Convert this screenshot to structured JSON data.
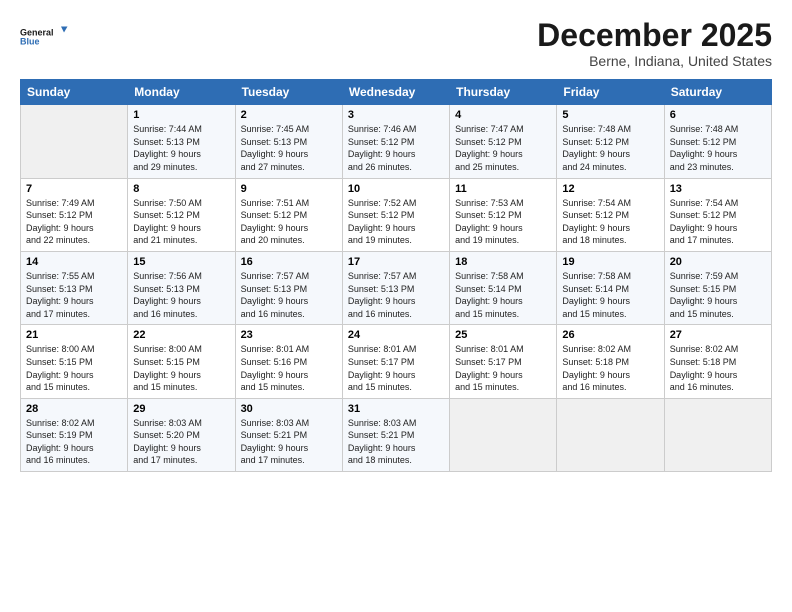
{
  "logo": {
    "line1": "General",
    "line2": "Blue"
  },
  "title": "December 2025",
  "subtitle": "Berne, Indiana, United States",
  "days_of_week": [
    "Sunday",
    "Monday",
    "Tuesday",
    "Wednesday",
    "Thursday",
    "Friday",
    "Saturday"
  ],
  "weeks": [
    [
      {
        "day": "",
        "info": ""
      },
      {
        "day": "1",
        "info": "Sunrise: 7:44 AM\nSunset: 5:13 PM\nDaylight: 9 hours\nand 29 minutes."
      },
      {
        "day": "2",
        "info": "Sunrise: 7:45 AM\nSunset: 5:13 PM\nDaylight: 9 hours\nand 27 minutes."
      },
      {
        "day": "3",
        "info": "Sunrise: 7:46 AM\nSunset: 5:12 PM\nDaylight: 9 hours\nand 26 minutes."
      },
      {
        "day": "4",
        "info": "Sunrise: 7:47 AM\nSunset: 5:12 PM\nDaylight: 9 hours\nand 25 minutes."
      },
      {
        "day": "5",
        "info": "Sunrise: 7:48 AM\nSunset: 5:12 PM\nDaylight: 9 hours\nand 24 minutes."
      },
      {
        "day": "6",
        "info": "Sunrise: 7:48 AM\nSunset: 5:12 PM\nDaylight: 9 hours\nand 23 minutes."
      }
    ],
    [
      {
        "day": "7",
        "info": "Sunrise: 7:49 AM\nSunset: 5:12 PM\nDaylight: 9 hours\nand 22 minutes."
      },
      {
        "day": "8",
        "info": "Sunrise: 7:50 AM\nSunset: 5:12 PM\nDaylight: 9 hours\nand 21 minutes."
      },
      {
        "day": "9",
        "info": "Sunrise: 7:51 AM\nSunset: 5:12 PM\nDaylight: 9 hours\nand 20 minutes."
      },
      {
        "day": "10",
        "info": "Sunrise: 7:52 AM\nSunset: 5:12 PM\nDaylight: 9 hours\nand 19 minutes."
      },
      {
        "day": "11",
        "info": "Sunrise: 7:53 AM\nSunset: 5:12 PM\nDaylight: 9 hours\nand 19 minutes."
      },
      {
        "day": "12",
        "info": "Sunrise: 7:54 AM\nSunset: 5:12 PM\nDaylight: 9 hours\nand 18 minutes."
      },
      {
        "day": "13",
        "info": "Sunrise: 7:54 AM\nSunset: 5:12 PM\nDaylight: 9 hours\nand 17 minutes."
      }
    ],
    [
      {
        "day": "14",
        "info": "Sunrise: 7:55 AM\nSunset: 5:13 PM\nDaylight: 9 hours\nand 17 minutes."
      },
      {
        "day": "15",
        "info": "Sunrise: 7:56 AM\nSunset: 5:13 PM\nDaylight: 9 hours\nand 16 minutes."
      },
      {
        "day": "16",
        "info": "Sunrise: 7:57 AM\nSunset: 5:13 PM\nDaylight: 9 hours\nand 16 minutes."
      },
      {
        "day": "17",
        "info": "Sunrise: 7:57 AM\nSunset: 5:13 PM\nDaylight: 9 hours\nand 16 minutes."
      },
      {
        "day": "18",
        "info": "Sunrise: 7:58 AM\nSunset: 5:14 PM\nDaylight: 9 hours\nand 15 minutes."
      },
      {
        "day": "19",
        "info": "Sunrise: 7:58 AM\nSunset: 5:14 PM\nDaylight: 9 hours\nand 15 minutes."
      },
      {
        "day": "20",
        "info": "Sunrise: 7:59 AM\nSunset: 5:15 PM\nDaylight: 9 hours\nand 15 minutes."
      }
    ],
    [
      {
        "day": "21",
        "info": "Sunrise: 8:00 AM\nSunset: 5:15 PM\nDaylight: 9 hours\nand 15 minutes."
      },
      {
        "day": "22",
        "info": "Sunrise: 8:00 AM\nSunset: 5:15 PM\nDaylight: 9 hours\nand 15 minutes."
      },
      {
        "day": "23",
        "info": "Sunrise: 8:01 AM\nSunset: 5:16 PM\nDaylight: 9 hours\nand 15 minutes."
      },
      {
        "day": "24",
        "info": "Sunrise: 8:01 AM\nSunset: 5:17 PM\nDaylight: 9 hours\nand 15 minutes."
      },
      {
        "day": "25",
        "info": "Sunrise: 8:01 AM\nSunset: 5:17 PM\nDaylight: 9 hours\nand 15 minutes."
      },
      {
        "day": "26",
        "info": "Sunrise: 8:02 AM\nSunset: 5:18 PM\nDaylight: 9 hours\nand 16 minutes."
      },
      {
        "day": "27",
        "info": "Sunrise: 8:02 AM\nSunset: 5:18 PM\nDaylight: 9 hours\nand 16 minutes."
      }
    ],
    [
      {
        "day": "28",
        "info": "Sunrise: 8:02 AM\nSunset: 5:19 PM\nDaylight: 9 hours\nand 16 minutes."
      },
      {
        "day": "29",
        "info": "Sunrise: 8:03 AM\nSunset: 5:20 PM\nDaylight: 9 hours\nand 17 minutes."
      },
      {
        "day": "30",
        "info": "Sunrise: 8:03 AM\nSunset: 5:21 PM\nDaylight: 9 hours\nand 17 minutes."
      },
      {
        "day": "31",
        "info": "Sunrise: 8:03 AM\nSunset: 5:21 PM\nDaylight: 9 hours\nand 18 minutes."
      },
      {
        "day": "",
        "info": ""
      },
      {
        "day": "",
        "info": ""
      },
      {
        "day": "",
        "info": ""
      }
    ]
  ]
}
